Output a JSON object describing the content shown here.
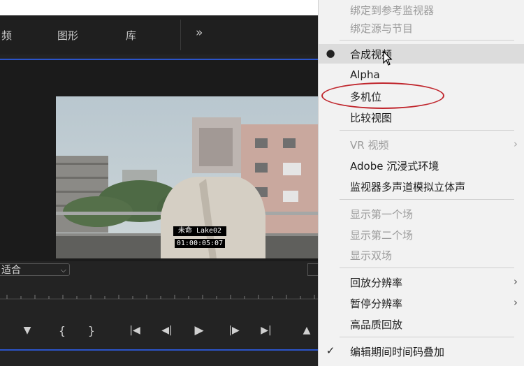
{
  "tabs": [
    {
      "label": "频"
    },
    {
      "label": "图形"
    },
    {
      "label": "库"
    },
    {
      "label": "»"
    }
  ],
  "overlay": {
    "name_line": "未命 Lake02",
    "timecode": "01:00:05:07"
  },
  "fit_select": {
    "value": "适合"
  },
  "menu": {
    "items": [
      {
        "label": "绑定到参考监视器",
        "disabled": true
      },
      {
        "label": "绑定源与节目",
        "disabled": true
      },
      {
        "label": "合成视频",
        "selected": true
      },
      {
        "label": "Alpha"
      },
      {
        "label": "多机位",
        "annotated": true
      },
      {
        "label": "比较视图"
      },
      {
        "label": "VR 视频",
        "disabled": true,
        "submenu": true
      },
      {
        "label": "Adobe 沉浸式环境"
      },
      {
        "label": "监视器多声道模拟立体声"
      },
      {
        "label": "显示第一个场",
        "disabled": true
      },
      {
        "label": "显示第二个场",
        "disabled": true
      },
      {
        "label": "显示双场",
        "disabled": true
      },
      {
        "label": "回放分辨率",
        "submenu": true
      },
      {
        "label": "暂停分辨率",
        "submenu": true
      },
      {
        "label": "高品质回放"
      },
      {
        "label": "编辑期间时间码叠加",
        "checked": true
      }
    ]
  },
  "colors": {
    "accent_blue": "#2b54c9",
    "annotation_red": "#c0262d"
  }
}
